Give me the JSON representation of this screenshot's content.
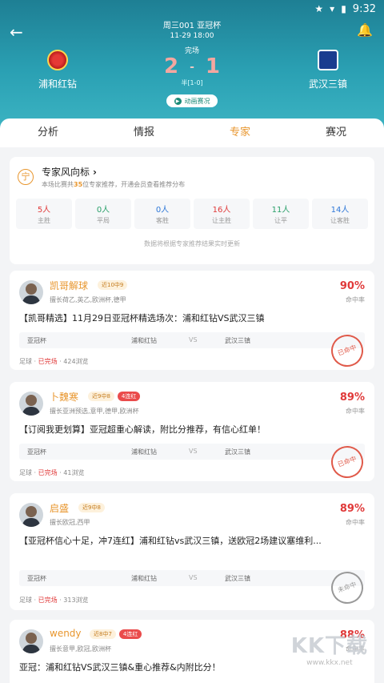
{
  "status_bar": {
    "time": "9:32"
  },
  "match": {
    "round": "周三001 亚冠杯",
    "datetime": "11-29 18:00",
    "status": "完场",
    "home_team": "浦和红钻",
    "away_team": "武汉三镇",
    "home_score": "2",
    "away_score": "1",
    "separator": "-",
    "half_time": "半[1-0]",
    "live_button": "动画赛况"
  },
  "tabs": [
    "分析",
    "情报",
    "专家",
    "赛况"
  ],
  "vane": {
    "icon_text": "宁",
    "title": "专家风向标",
    "sub_prefix": "本场比赛共",
    "expert_count": "35",
    "sub_suffix": "位专家推荐，开通会员查看推荐分布",
    "stats": [
      {
        "num": "5人",
        "label": "主胜",
        "color": "#e03a3a"
      },
      {
        "num": "0人",
        "label": "平局",
        "color": "#2aa06a"
      },
      {
        "num": "0人",
        "label": "客胜",
        "color": "#2f78d8"
      },
      {
        "num": "16人",
        "label": "让主胜",
        "color": "#e03a3a"
      },
      {
        "num": "11人",
        "label": "让平",
        "color": "#2aa06a"
      },
      {
        "num": "14人",
        "label": "让客胜",
        "color": "#2f78d8"
      }
    ],
    "note": "数据将根据专家推荐结果实时更新"
  },
  "experts": [
    {
      "name": "凯哥解球",
      "recent": "近10中9",
      "hot": "",
      "specialty": "擅长荷乙,英乙,欧洲杯,德甲",
      "rate": "90%",
      "rate_label": "命中率",
      "title": "【凯哥精选】11月29日亚冠杯精选场次：浦和红钻VS武汉三镇",
      "league": "亚冠杯",
      "home": "浦和红钻",
      "vs": "VS",
      "away": "武汉三镇",
      "sport": "足球",
      "dot1": "·",
      "state": "已完场",
      "dot2": "·",
      "views": "424浏览",
      "stamp": "已命中"
    },
    {
      "name": "卜魏寒",
      "recent": "近9中8",
      "hot": "4连红",
      "specialty": "擅长亚洲预选,意甲,德甲,欧洲杯",
      "rate": "89%",
      "rate_label": "命中率",
      "title": "【订阅我更划算】亚冠超重心解读，附比分推荐，有信心红单！",
      "league": "亚冠杯",
      "home": "浦和红钻",
      "vs": "VS",
      "away": "武汉三镇",
      "sport": "足球",
      "dot1": "·",
      "state": "已完场",
      "dot2": "·",
      "views": "41浏览",
      "stamp": "已命中"
    },
    {
      "name": "启盛",
      "recent": "近9中8",
      "hot": "",
      "specialty": "擅长欧冠,西甲",
      "rate": "89%",
      "rate_label": "命中率",
      "title": "【亚冠杯信心十足，冲7连红】浦和红钻vs武汉三镇，送欧冠2场建议塞维利...",
      "league": "亚冠杯",
      "home": "浦和红钻",
      "vs": "VS",
      "away": "武汉三镇",
      "sport": "足球",
      "dot1": "·",
      "state": "已完场",
      "dot2": "·",
      "views": "313浏览",
      "stamp": "未命中"
    },
    {
      "name": "wendy",
      "recent": "近8中7",
      "hot": "4连红",
      "specialty": "擅长意甲,欧冠,欧洲杯",
      "rate": "88%",
      "rate_label": "命中率",
      "title": "亚冠：浦和红钻VS武汉三镇&重心推荐&内附比分！"
    }
  ],
  "watermark": {
    "big": "KK下载",
    "small": "www.kkx.net"
  }
}
